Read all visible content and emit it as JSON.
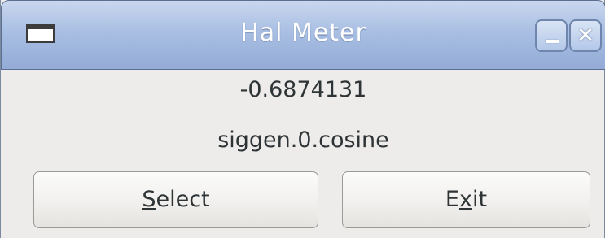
{
  "window": {
    "title": "Hal Meter",
    "app_icon": "window-icon",
    "minimize_icon": "minimize-icon",
    "close_icon": "close-icon"
  },
  "meter": {
    "value": "-0.6874131",
    "pin_name": "siggen.0.cosine"
  },
  "buttons": {
    "select": {
      "mnemonic": "S",
      "rest": "elect"
    },
    "exit": {
      "before": "E",
      "mnemonic": "x",
      "after": "it"
    }
  },
  "colors": {
    "titlebar_top": "#c9d7ee",
    "titlebar_bottom": "#93abd6",
    "window_bg": "#edeceb",
    "text": "#2e3436"
  }
}
